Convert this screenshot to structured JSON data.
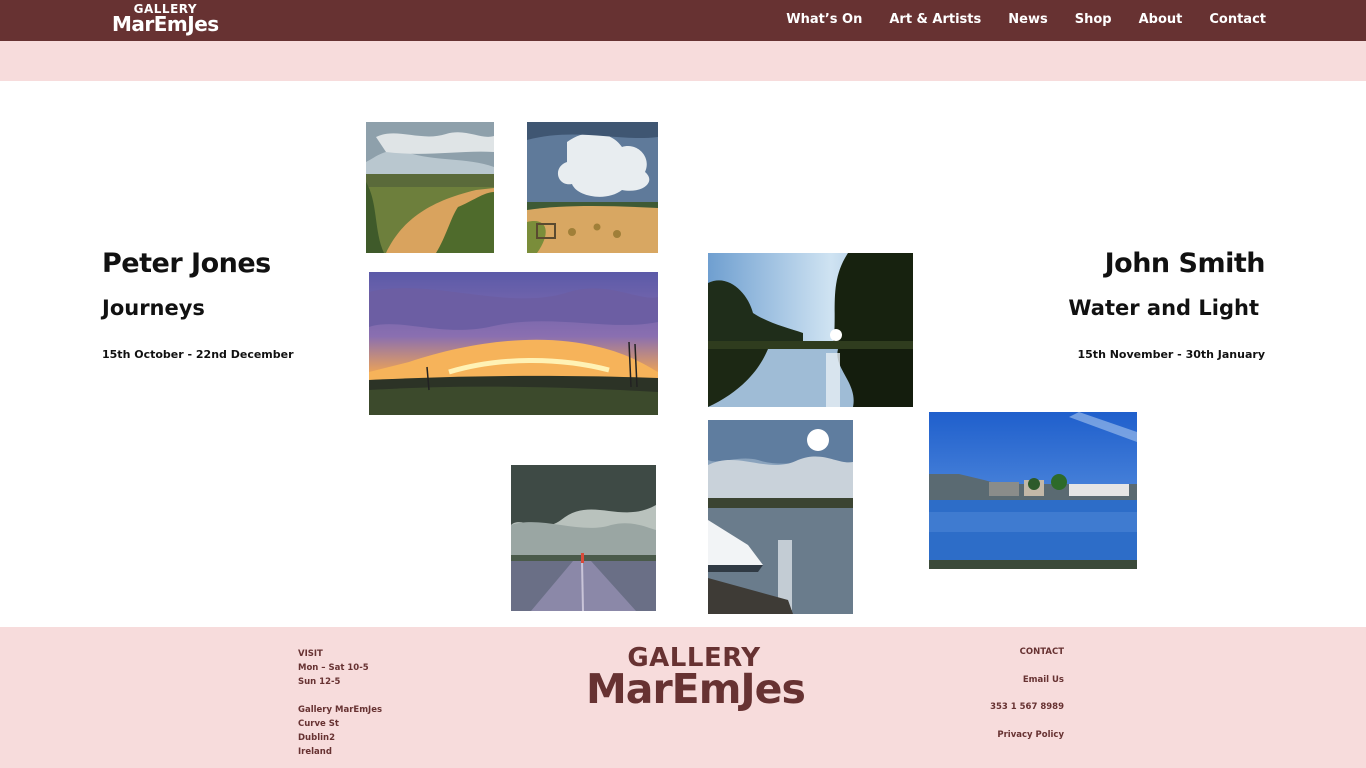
{
  "header": {
    "logo_line1": "GALLERY",
    "logo_line2": "MarEmJes",
    "nav": [
      "What’s On",
      "Art & Artists",
      "News",
      "Shop",
      "About",
      "Contact"
    ]
  },
  "exhibitions": [
    {
      "artist": "Peter Jones",
      "title": "Journeys",
      "dates": "15th October -  22nd December"
    },
    {
      "artist": "John Smith",
      "title": "Water and Light",
      "dates": "15th November -  30th January"
    }
  ],
  "footer": {
    "visit_heading": "VISIT",
    "hours": [
      "Mon – Sat 10-5",
      "Sun 12-5"
    ],
    "address": [
      "Gallery MarEmJes",
      "Curve St",
      "Dublin2",
      "Ireland"
    ],
    "logo_line1": "GALLERY",
    "logo_line2": "MarEmJes",
    "contact_heading": "CONTACT",
    "email_label": "Email Us",
    "phone": "353 1 567 8989",
    "privacy_label": "Privacy Policy"
  },
  "colors": {
    "brand": "#673232",
    "band": "#f7dcdc",
    "background": "#ffffff"
  }
}
